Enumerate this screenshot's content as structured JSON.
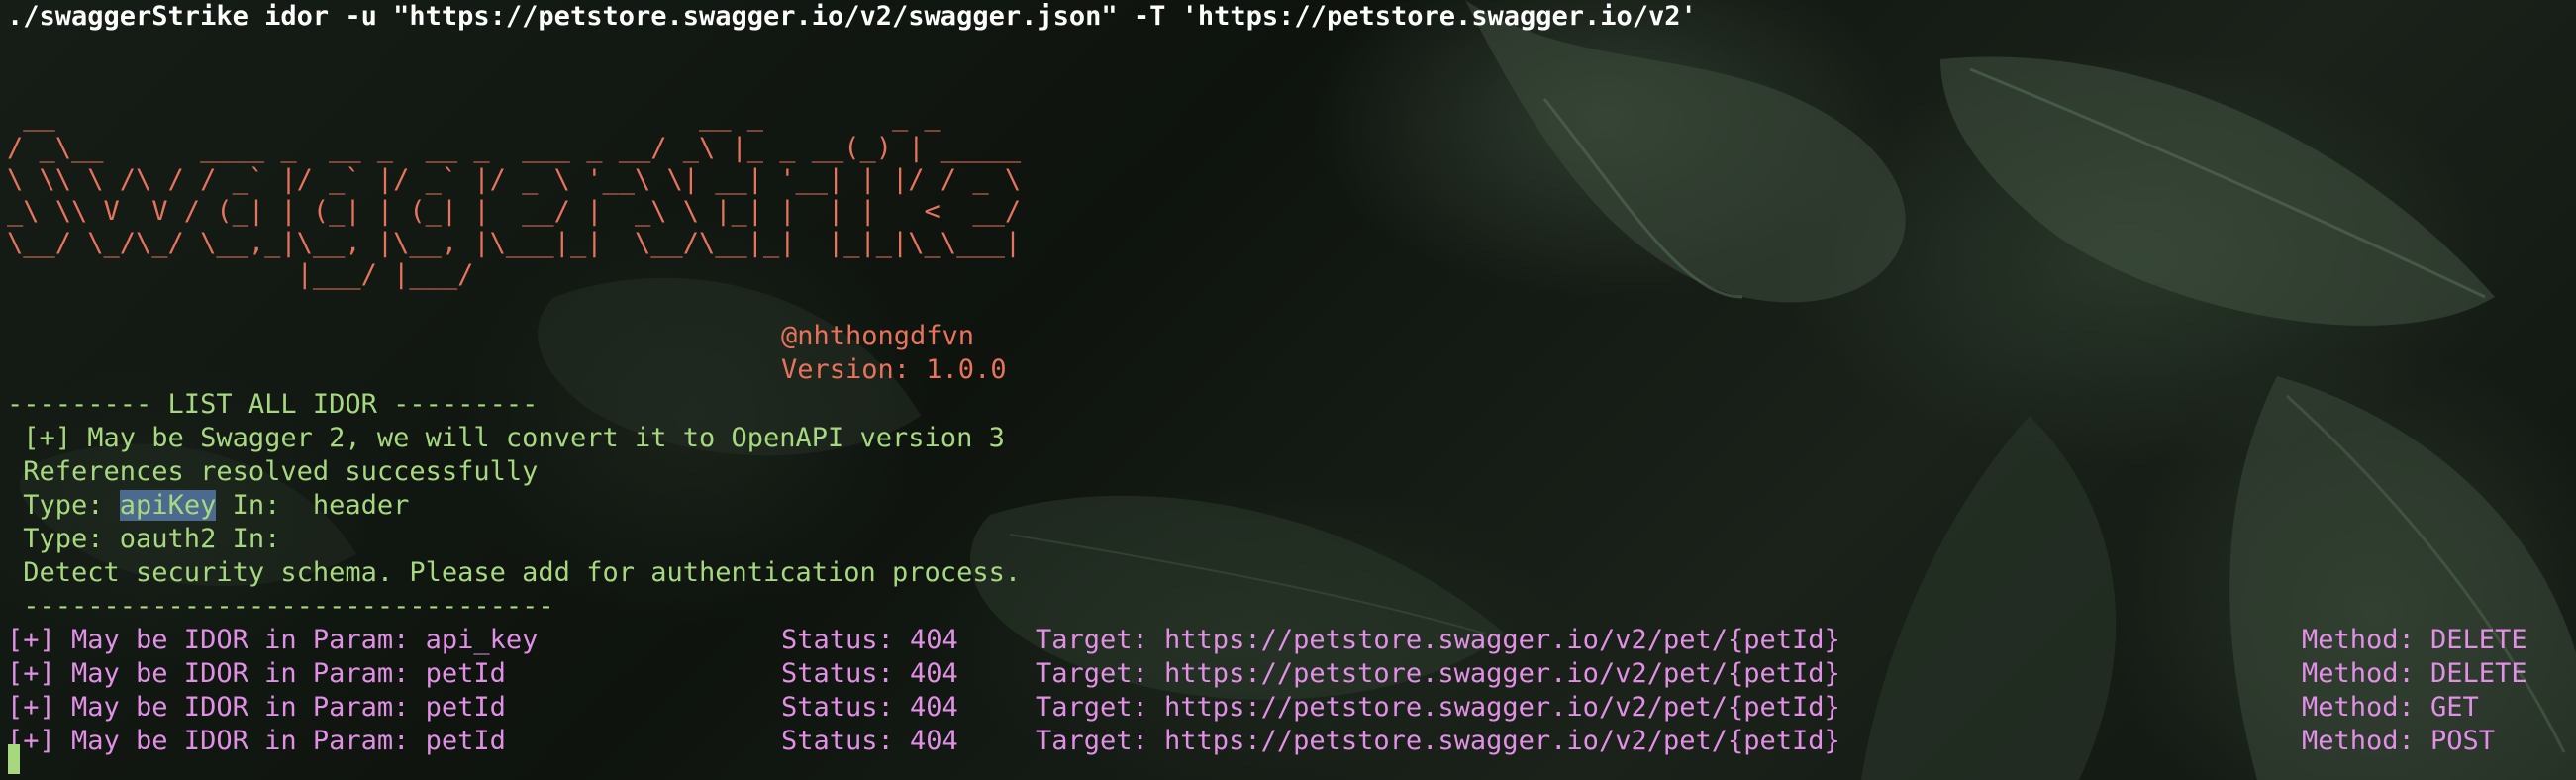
{
  "terminal": {
    "command": "./swaggerStrike idor -u \"https://petstore.swagger.io/v2/swagger.json\" -T 'https://petstore.swagger.io/v2'",
    "banner_lines": [
      " __                                        __ _        _ _",
      "/ _\\__      ____ _  __ _  __ _  ___ _ __/ _\\ |_ _ __(_) | _____",
      "\\ \\\\ \\ /\\ / / _` |/ _` |/ _` |/ _ \\ '__\\ \\| __| '__| | |/ / _ \\",
      "_\\ \\\\ V  V / (_| | (_| | (_| |  __/ |  _\\ \\ |_| |  | |   <  __/",
      "\\__/ \\_/\\_/ \\__,_|\\__, |\\__, |\\___|_|  \\__/\\__|_|  |_|_|\\_\\___|",
      "                  |___/ |___/"
    ],
    "author": "@nhthongdfvn",
    "version": "Version: 1.0.0",
    "section_header": "--------- LIST ALL IDOR ---------",
    "messages": {
      "swagger_convert": " [+] May be Swagger 2, we will convert it to OpenAPI version 3",
      "references": " References resolved successfully",
      "type1_prefix": " Type: ",
      "type1_value": "apiKey",
      "type1_suffix": " In:  header",
      "type2": " Type: oauth2 In:",
      "detect": " Detect security schema. Please add for authentication process.",
      "separator": " ---------------------------------"
    },
    "results": [
      {
        "param": "[+] May be IDOR in Param: api_key",
        "status": "Status: 404",
        "target": "Target: https://petstore.swagger.io/v2/pet/{petId}",
        "method": "Method: DELETE"
      },
      {
        "param": "[+] May be IDOR in Param: petId",
        "status": "Status: 404",
        "target": "Target: https://petstore.swagger.io/v2/pet/{petId}",
        "method": "Method: DELETE"
      },
      {
        "param": "[+] May be IDOR in Param: petId",
        "status": "Status: 404",
        "target": "Target: https://petstore.swagger.io/v2/pet/{petId}",
        "method": "Method: GET"
      },
      {
        "param": "[+] May be IDOR in Param: petId",
        "status": "Status: 404",
        "target": "Target: https://petstore.swagger.io/v2/pet/{petId}",
        "method": "Method: POST"
      }
    ]
  },
  "colors": {
    "banner": "#e8735c",
    "green": "#a7d87f",
    "magenta": "#e190e6",
    "command": "#ffffff"
  }
}
